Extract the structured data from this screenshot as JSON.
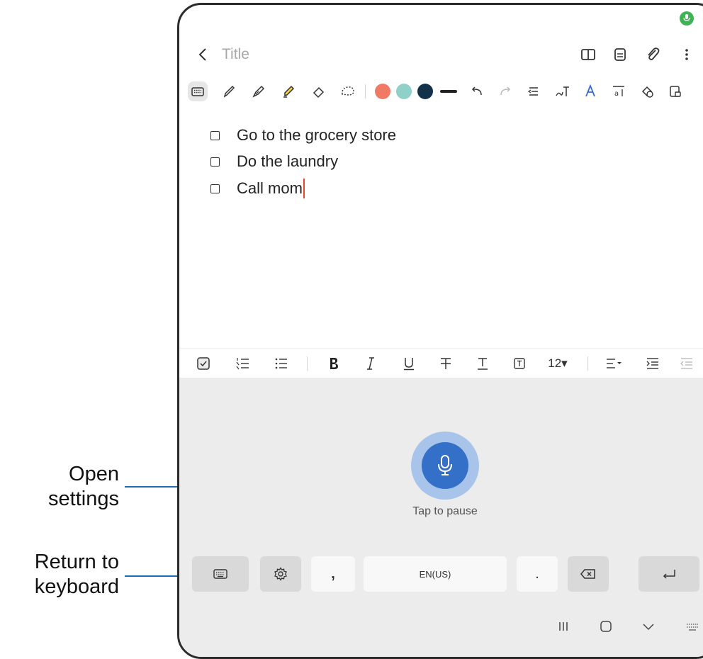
{
  "note": {
    "title_placeholder": "Title",
    "items": [
      {
        "text": "Go to the grocery store",
        "checked": false
      },
      {
        "text": "Do the laundry",
        "checked": false
      },
      {
        "text": "Call mom",
        "checked": false
      }
    ]
  },
  "pen_colors": [
    "#f07a63",
    "#8fd1c8",
    "#13324a"
  ],
  "format_bar": {
    "font_size": "12▾"
  },
  "voice": {
    "status_label": "Tap to pause",
    "keys": {
      "comma": ",",
      "space": "EN(US)",
      "period": "."
    }
  },
  "callouts": {
    "open_settings": "Open\nsettings",
    "return_keyboard": "Return to\nkeyboard"
  },
  "colors": {
    "mic_blue": "#3570c8",
    "mic_halo": "#a9c4ea",
    "recording_indicator": "#3eb255",
    "callout_line": "#1f6fb0"
  }
}
